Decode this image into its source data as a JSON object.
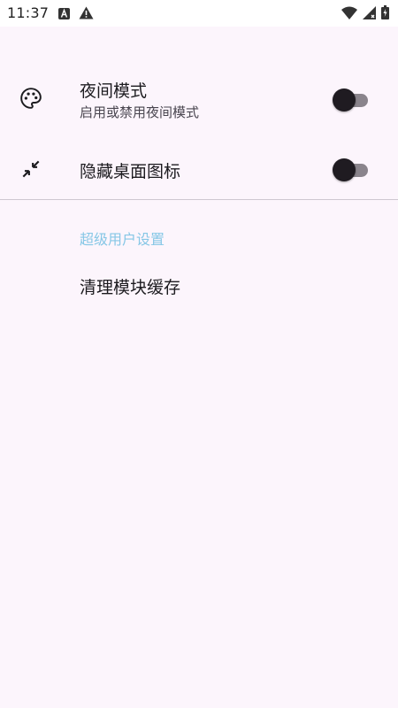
{
  "status_bar": {
    "time": "11:37",
    "left_icons": [
      "a-notification-icon",
      "warning-icon"
    ],
    "right_icons": [
      "wifi-icon",
      "signal-icon",
      "battery-icon"
    ]
  },
  "settings": {
    "night_mode": {
      "icon": "palette-icon",
      "title": "夜间模式",
      "summary": "启用或禁用夜间模式",
      "enabled": false
    },
    "hide_launcher_icon": {
      "icon": "shrink-arrows-icon",
      "title": "隐藏桌面图标",
      "enabled": false
    },
    "superuser_section": {
      "title": "超级用户设置",
      "accent_color": "#86c7e6"
    },
    "clear_cache": {
      "title": "清理模块缓存"
    }
  },
  "colors": {
    "background": "#fcf5fc",
    "switch_track_off": "#8a848c",
    "switch_thumb_off": "#1f1b21",
    "divider": "#cfc8d1"
  }
}
